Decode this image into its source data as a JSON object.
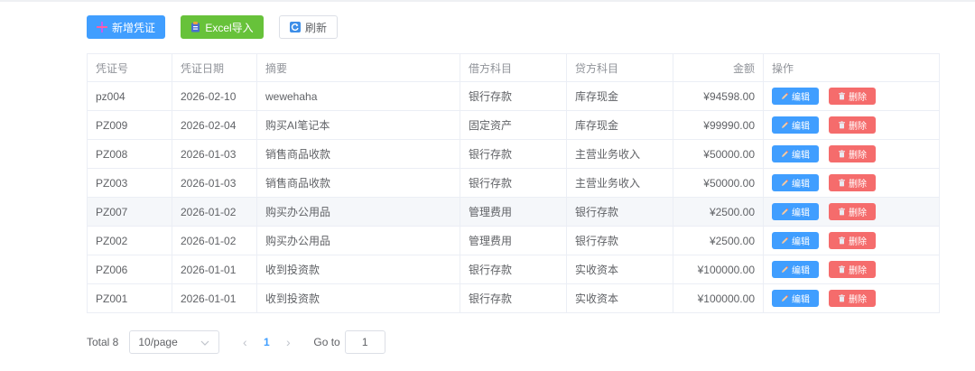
{
  "toolbar": {
    "add_label": "新增凭证",
    "excel_label": "Excel导入",
    "refresh_label": "刷新"
  },
  "table": {
    "headers": {
      "voucher_no": "凭证号",
      "date": "凭证日期",
      "summary": "摘要",
      "debit": "借方科目",
      "credit": "贷方科目",
      "amount": "金额",
      "action": "操作"
    },
    "rows": [
      {
        "voucher_no": "pz004",
        "date": "2026-02-10",
        "summary": "wewehaha",
        "debit": "银行存款",
        "credit": "库存现金",
        "amount": "¥94598.00"
      },
      {
        "voucher_no": "PZ009",
        "date": "2026-02-04",
        "summary": "购买AI笔记本",
        "debit": "固定资产",
        "credit": "库存现金",
        "amount": "¥99990.00"
      },
      {
        "voucher_no": "PZ008",
        "date": "2026-01-03",
        "summary": "销售商品收款",
        "debit": "银行存款",
        "credit": "主营业务收入",
        "amount": "¥50000.00"
      },
      {
        "voucher_no": "PZ003",
        "date": "2026-01-03",
        "summary": "销售商品收款",
        "debit": "银行存款",
        "credit": "主营业务收入",
        "amount": "¥50000.00"
      },
      {
        "voucher_no": "PZ007",
        "date": "2026-01-02",
        "summary": "购买办公用品",
        "debit": "管理费用",
        "credit": "银行存款",
        "amount": "¥2500.00"
      },
      {
        "voucher_no": "PZ002",
        "date": "2026-01-02",
        "summary": "购买办公用品",
        "debit": "管理费用",
        "credit": "银行存款",
        "amount": "¥2500.00"
      },
      {
        "voucher_no": "PZ006",
        "date": "2026-01-01",
        "summary": "收到投资款",
        "debit": "银行存款",
        "credit": "实收资本",
        "amount": "¥100000.00"
      },
      {
        "voucher_no": "PZ001",
        "date": "2026-01-01",
        "summary": "收到投资款",
        "debit": "银行存款",
        "credit": "实收资本",
        "amount": "¥100000.00"
      }
    ],
    "highlight_row": 4,
    "edit_label": "编辑",
    "delete_label": "删除"
  },
  "pagination": {
    "total_label": "Total 8",
    "page_size": "10/page",
    "current_page": "1",
    "goto_label": "Go to",
    "goto_value": "1"
  },
  "colors": {
    "primary": "#409eff",
    "success": "#67c23a",
    "danger": "#f56c6c"
  }
}
